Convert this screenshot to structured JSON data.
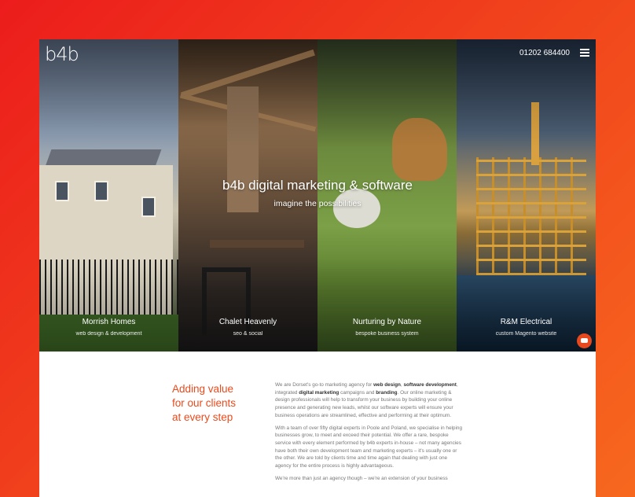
{
  "header": {
    "logo_text": "b4b",
    "phone": "01202 684400",
    "menu_icon": "hamburger-menu-icon"
  },
  "hero": {
    "title": "b4b digital marketing & software",
    "subtitle": "imagine the possibilities"
  },
  "projects": [
    {
      "title": "Morrish Homes",
      "subtitle": "web design & development"
    },
    {
      "title": "Chalet Heavenly",
      "subtitle": "seo & social"
    },
    {
      "title": "Nurturing by Nature",
      "subtitle": "bespoke business system"
    },
    {
      "title": "R&M Electrical",
      "subtitle": "custom Magento website"
    }
  ],
  "intro": {
    "headline_lines": [
      "Adding value",
      "for our clients",
      "at every step"
    ],
    "p1": {
      "a": "We are Dorset's go-to marketing agency for ",
      "b": "web design",
      "c": ", ",
      "d": "software development",
      "e": ", integrated ",
      "f": "digital marketing",
      "g": " campaigns and ",
      "h": "branding",
      "i": ". Our online marketing & design professionals will help to transform your business by building your online presence and generating new leads, whilst our software experts will ensure your business operations are streamlined, effective and performing at their optimum."
    },
    "p2": "With a team of over fifty digital experts in Poole and Poland, we specialise in helping businesses grow, to meet and exceed their potential. We offer a rare, bespoke service with every element performed by b4b experts in-house – not many agencies have both their own development team and marketing experts – it's usually one or the other. We are told by clients time and time again that dealing with just one agency for the entire process is highly advantageous.",
    "p3": "We're more than just an agency though – we're an extension of your business"
  },
  "colors": {
    "accent": "#ec4a1c",
    "background_start": "#ec1c1c",
    "background_end": "#f7681e"
  },
  "chat_icon": "chat-bubble-icon"
}
